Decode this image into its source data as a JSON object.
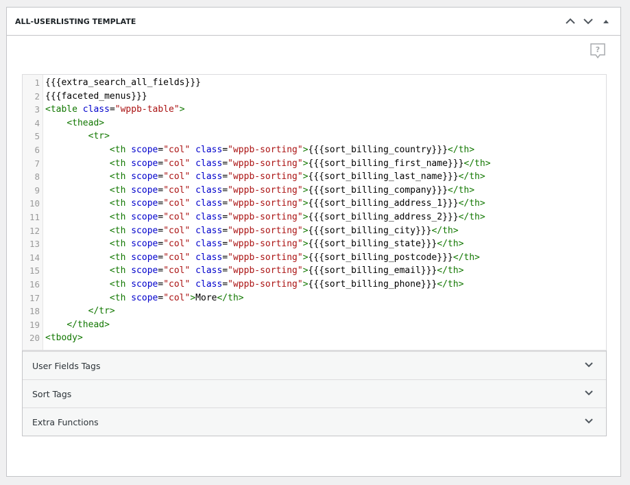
{
  "postbox": {
    "title": "ALL-USERLISTING TEMPLATE",
    "icons": [
      "chevron-up-icon",
      "chevron-down-icon",
      "caret-up-icon",
      "help-icon"
    ]
  },
  "code_lines": [
    {
      "num": "1",
      "indent": 0,
      "tokens": [
        {
          "t": "txt",
          "v": "{{{extra_search_all_fields}}}"
        }
      ]
    },
    {
      "num": "2",
      "indent": 0,
      "tokens": [
        {
          "t": "txt",
          "v": "{{{faceted_menus}}}"
        }
      ]
    },
    {
      "num": "3",
      "indent": 0,
      "tokens": [
        {
          "t": "tag",
          "v": "<table "
        },
        {
          "t": "attr",
          "v": "class"
        },
        {
          "t": "txt",
          "v": "="
        },
        {
          "t": "str",
          "v": "\"wppb-table\""
        },
        {
          "t": "tag",
          "v": ">"
        }
      ]
    },
    {
      "num": "4",
      "indent": 4,
      "tokens": [
        {
          "t": "tag",
          "v": "<thead>"
        }
      ]
    },
    {
      "num": "5",
      "indent": 8,
      "tokens": [
        {
          "t": "tag",
          "v": "<tr>"
        }
      ]
    },
    {
      "num": "6",
      "indent": 12,
      "tokens": [
        {
          "t": "tag",
          "v": "<th "
        },
        {
          "t": "attr",
          "v": "scope"
        },
        {
          "t": "txt",
          "v": "="
        },
        {
          "t": "str",
          "v": "\"col\""
        },
        {
          "t": "txt",
          "v": " "
        },
        {
          "t": "attr",
          "v": "class"
        },
        {
          "t": "txt",
          "v": "="
        },
        {
          "t": "str",
          "v": "\"wppb-sorting\""
        },
        {
          "t": "tag",
          "v": ">"
        },
        {
          "t": "txt",
          "v": "{{{sort_billing_country}}}"
        },
        {
          "t": "tag",
          "v": "</th>"
        }
      ]
    },
    {
      "num": "7",
      "indent": 12,
      "tokens": [
        {
          "t": "tag",
          "v": "<th "
        },
        {
          "t": "attr",
          "v": "scope"
        },
        {
          "t": "txt",
          "v": "="
        },
        {
          "t": "str",
          "v": "\"col\""
        },
        {
          "t": "txt",
          "v": " "
        },
        {
          "t": "attr",
          "v": "class"
        },
        {
          "t": "txt",
          "v": "="
        },
        {
          "t": "str",
          "v": "\"wppb-sorting\""
        },
        {
          "t": "tag",
          "v": ">"
        },
        {
          "t": "txt",
          "v": "{{{sort_billing_first_name}}}"
        },
        {
          "t": "tag",
          "v": "</th>"
        }
      ]
    },
    {
      "num": "8",
      "indent": 12,
      "tokens": [
        {
          "t": "tag",
          "v": "<th "
        },
        {
          "t": "attr",
          "v": "scope"
        },
        {
          "t": "txt",
          "v": "="
        },
        {
          "t": "str",
          "v": "\"col\""
        },
        {
          "t": "txt",
          "v": " "
        },
        {
          "t": "attr",
          "v": "class"
        },
        {
          "t": "txt",
          "v": "="
        },
        {
          "t": "str",
          "v": "\"wppb-sorting\""
        },
        {
          "t": "tag",
          "v": ">"
        },
        {
          "t": "txt",
          "v": "{{{sort_billing_last_name}}}"
        },
        {
          "t": "tag",
          "v": "</th>"
        }
      ]
    },
    {
      "num": "9",
      "indent": 12,
      "tokens": [
        {
          "t": "tag",
          "v": "<th "
        },
        {
          "t": "attr",
          "v": "scope"
        },
        {
          "t": "txt",
          "v": "="
        },
        {
          "t": "str",
          "v": "\"col\""
        },
        {
          "t": "txt",
          "v": " "
        },
        {
          "t": "attr",
          "v": "class"
        },
        {
          "t": "txt",
          "v": "="
        },
        {
          "t": "str",
          "v": "\"wppb-sorting\""
        },
        {
          "t": "tag",
          "v": ">"
        },
        {
          "t": "txt",
          "v": "{{{sort_billing_company}}}"
        },
        {
          "t": "tag",
          "v": "</th>"
        }
      ]
    },
    {
      "num": "10",
      "indent": 12,
      "tokens": [
        {
          "t": "tag",
          "v": "<th "
        },
        {
          "t": "attr",
          "v": "scope"
        },
        {
          "t": "txt",
          "v": "="
        },
        {
          "t": "str",
          "v": "\"col\""
        },
        {
          "t": "txt",
          "v": " "
        },
        {
          "t": "attr",
          "v": "class"
        },
        {
          "t": "txt",
          "v": "="
        },
        {
          "t": "str",
          "v": "\"wppb-sorting\""
        },
        {
          "t": "tag",
          "v": ">"
        },
        {
          "t": "txt",
          "v": "{{{sort_billing_address_1}}}"
        },
        {
          "t": "tag",
          "v": "</th>"
        }
      ]
    },
    {
      "num": "11",
      "indent": 12,
      "tokens": [
        {
          "t": "tag",
          "v": "<th "
        },
        {
          "t": "attr",
          "v": "scope"
        },
        {
          "t": "txt",
          "v": "="
        },
        {
          "t": "str",
          "v": "\"col\""
        },
        {
          "t": "txt",
          "v": " "
        },
        {
          "t": "attr",
          "v": "class"
        },
        {
          "t": "txt",
          "v": "="
        },
        {
          "t": "str",
          "v": "\"wppb-sorting\""
        },
        {
          "t": "tag",
          "v": ">"
        },
        {
          "t": "txt",
          "v": "{{{sort_billing_address_2}}}"
        },
        {
          "t": "tag",
          "v": "</th>"
        }
      ]
    },
    {
      "num": "12",
      "indent": 12,
      "tokens": [
        {
          "t": "tag",
          "v": "<th "
        },
        {
          "t": "attr",
          "v": "scope"
        },
        {
          "t": "txt",
          "v": "="
        },
        {
          "t": "str",
          "v": "\"col\""
        },
        {
          "t": "txt",
          "v": " "
        },
        {
          "t": "attr",
          "v": "class"
        },
        {
          "t": "txt",
          "v": "="
        },
        {
          "t": "str",
          "v": "\"wppb-sorting\""
        },
        {
          "t": "tag",
          "v": ">"
        },
        {
          "t": "txt",
          "v": "{{{sort_billing_city}}}"
        },
        {
          "t": "tag",
          "v": "</th>"
        }
      ]
    },
    {
      "num": "13",
      "indent": 12,
      "tokens": [
        {
          "t": "tag",
          "v": "<th "
        },
        {
          "t": "attr",
          "v": "scope"
        },
        {
          "t": "txt",
          "v": "="
        },
        {
          "t": "str",
          "v": "\"col\""
        },
        {
          "t": "txt",
          "v": " "
        },
        {
          "t": "attr",
          "v": "class"
        },
        {
          "t": "txt",
          "v": "="
        },
        {
          "t": "str",
          "v": "\"wppb-sorting\""
        },
        {
          "t": "tag",
          "v": ">"
        },
        {
          "t": "txt",
          "v": "{{{sort_billing_state}}}"
        },
        {
          "t": "tag",
          "v": "</th>"
        }
      ]
    },
    {
      "num": "14",
      "indent": 12,
      "tokens": [
        {
          "t": "tag",
          "v": "<th "
        },
        {
          "t": "attr",
          "v": "scope"
        },
        {
          "t": "txt",
          "v": "="
        },
        {
          "t": "str",
          "v": "\"col\""
        },
        {
          "t": "txt",
          "v": " "
        },
        {
          "t": "attr",
          "v": "class"
        },
        {
          "t": "txt",
          "v": "="
        },
        {
          "t": "str",
          "v": "\"wppb-sorting\""
        },
        {
          "t": "tag",
          "v": ">"
        },
        {
          "t": "txt",
          "v": "{{{sort_billing_postcode}}}"
        },
        {
          "t": "tag",
          "v": "</th>"
        }
      ]
    },
    {
      "num": "15",
      "indent": 12,
      "tokens": [
        {
          "t": "tag",
          "v": "<th "
        },
        {
          "t": "attr",
          "v": "scope"
        },
        {
          "t": "txt",
          "v": "="
        },
        {
          "t": "str",
          "v": "\"col\""
        },
        {
          "t": "txt",
          "v": " "
        },
        {
          "t": "attr",
          "v": "class"
        },
        {
          "t": "txt",
          "v": "="
        },
        {
          "t": "str",
          "v": "\"wppb-sorting\""
        },
        {
          "t": "tag",
          "v": ">"
        },
        {
          "t": "txt",
          "v": "{{{sort_billing_email}}}"
        },
        {
          "t": "tag",
          "v": "</th>"
        }
      ]
    },
    {
      "num": "16",
      "indent": 12,
      "tokens": [
        {
          "t": "tag",
          "v": "<th "
        },
        {
          "t": "attr",
          "v": "scope"
        },
        {
          "t": "txt",
          "v": "="
        },
        {
          "t": "str",
          "v": "\"col\""
        },
        {
          "t": "txt",
          "v": " "
        },
        {
          "t": "attr",
          "v": "class"
        },
        {
          "t": "txt",
          "v": "="
        },
        {
          "t": "str",
          "v": "\"wppb-sorting\""
        },
        {
          "t": "tag",
          "v": ">"
        },
        {
          "t": "txt",
          "v": "{{{sort_billing_phone}}}"
        },
        {
          "t": "tag",
          "v": "</th>"
        }
      ]
    },
    {
      "num": "17",
      "indent": 12,
      "tokens": [
        {
          "t": "tag",
          "v": "<th "
        },
        {
          "t": "attr",
          "v": "scope"
        },
        {
          "t": "txt",
          "v": "="
        },
        {
          "t": "str",
          "v": "\"col\""
        },
        {
          "t": "tag",
          "v": ">"
        },
        {
          "t": "txt",
          "v": "More"
        },
        {
          "t": "tag",
          "v": "</th>"
        }
      ]
    },
    {
      "num": "18",
      "indent": 8,
      "tokens": [
        {
          "t": "tag",
          "v": "</tr>"
        }
      ]
    },
    {
      "num": "19",
      "indent": 4,
      "tokens": [
        {
          "t": "tag",
          "v": "</thead>"
        }
      ]
    },
    {
      "num": "20",
      "indent": 0,
      "tokens": [
        {
          "t": "tag",
          "v": "<tbody>"
        }
      ]
    }
  ],
  "accordion": [
    {
      "label": "User Fields Tags"
    },
    {
      "label": "Sort Tags"
    },
    {
      "label": "Extra Functions"
    }
  ],
  "colors": {
    "tag": "#117700",
    "attr": "#0000cc",
    "string": "#aa1111",
    "text": "#000000"
  }
}
